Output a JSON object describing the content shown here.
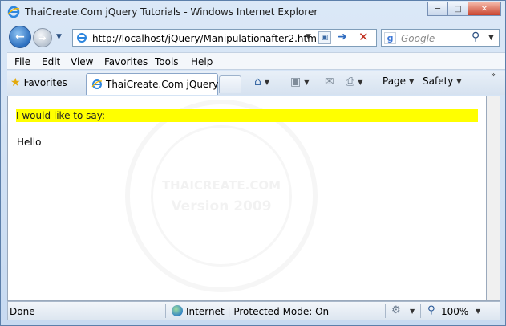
{
  "window": {
    "title": "ThaiCreate.Com jQuery Tutorials - Windows Internet Explorer"
  },
  "address": {
    "url": "http://localhost/jQuery/Manipulationafter2.html"
  },
  "search": {
    "placeholder": "Google"
  },
  "menu": {
    "items": [
      "File",
      "Edit",
      "View",
      "Favorites",
      "Tools",
      "Help"
    ]
  },
  "favorites_bar": {
    "favorites_label": "Favorites",
    "tab_title": "ThaiCreate.Com jQuery ...",
    "page_label": "Page",
    "safety_label": "Safety"
  },
  "content": {
    "highlight_text": "I would like to say:",
    "body_text": "Hello",
    "watermark_title": "THAICREATE.COM",
    "watermark_version": "Version 2009"
  },
  "status": {
    "text": "Done",
    "zone": "Internet | Protected Mode: On",
    "zoom": "100%"
  },
  "colors": {
    "highlight": "#ffff00",
    "frame": "#5c7faa"
  }
}
